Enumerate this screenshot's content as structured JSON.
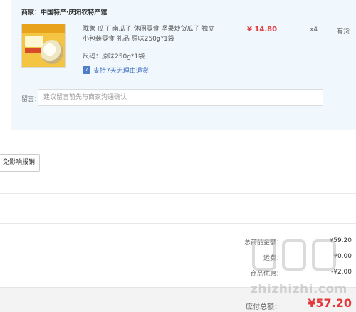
{
  "shop": {
    "label": "商家：",
    "name": "中国特产·庆阳农特产馆"
  },
  "product": {
    "title": "陇象 瓜子 南瓜子 休闲零食 坚果炒货瓜子 独立小包装零食 礼品 原味250g*1袋",
    "spec_label": "尺码：",
    "spec_value": "原味250g*1袋",
    "return_icon": "7",
    "return_text": "支持7天无理由退货",
    "price": "¥ 14.80",
    "qty": "x4",
    "stock": "有货"
  },
  "remark": {
    "label": "留言：",
    "placeholder": "建议留言前先与商家沟通确认"
  },
  "invoice": {
    "button_label": "免影响报销"
  },
  "summary": {
    "goods_total_label": "总商品金额：",
    "goods_total_value": "¥59.20",
    "freight_label": "运费：",
    "freight_value": "¥0.00",
    "discount_label": "商品优惠：",
    "discount_value": "-¥2.00"
  },
  "payable": {
    "label": "应付总额：",
    "value": "¥57.20"
  },
  "watermark": {
    "text": "zhizhizhi.com"
  },
  "colors": {
    "accent": "#e4393c",
    "card_bg": "#f1f8fd",
    "link": "#3e6dbf"
  }
}
